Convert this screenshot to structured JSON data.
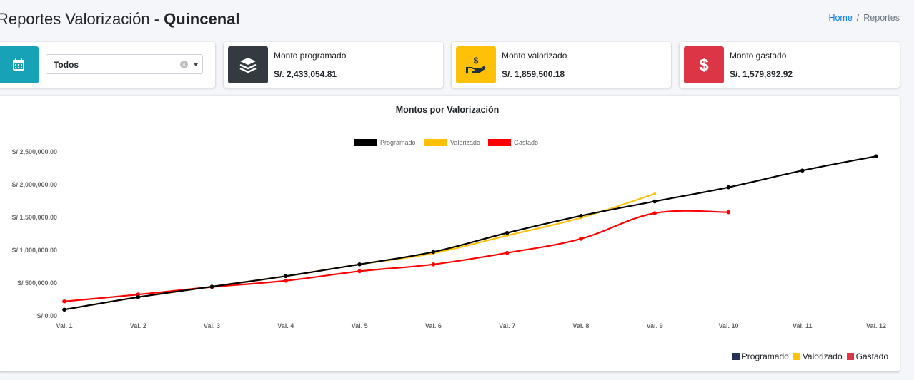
{
  "header": {
    "title_prefix": "Reportes Valorización - ",
    "title_bold": "Quincenal",
    "breadcrumb": {
      "home": "Home",
      "separator": "/",
      "current": "Reportes"
    }
  },
  "filter": {
    "icon": "calendar-icon",
    "selected": "Todos",
    "color": "#17a2b8"
  },
  "info_boxes": [
    {
      "label": "Monto programado",
      "value": "S/. 2,433,054.81",
      "icon": "layers-icon",
      "color": "#343a40"
    },
    {
      "label": "Monto valorizado",
      "value": "S/. 1,859,500.18",
      "icon": "hand-money-icon",
      "color": "#ffc107"
    },
    {
      "label": "Monto gastado",
      "value": "S/. 1,579,892.92",
      "icon": "dollar-icon",
      "color": "#dc3545"
    }
  ],
  "chart_data": {
    "type": "line",
    "title": "Montos por Valorización",
    "categories": [
      "Val. 1",
      "Val. 2",
      "Val. 3",
      "Val. 4",
      "Val. 5",
      "Val. 6",
      "Val. 7",
      "Val. 8",
      "Val. 9",
      "Val. 10",
      "Val. 11",
      "Val. 12"
    ],
    "y_ticks": [
      {
        "value": 0,
        "label": "S/ 0.00"
      },
      {
        "value": 500000,
        "label": "S/ 500,000.00"
      },
      {
        "value": 1000000,
        "label": "S/ 1,000,000.00"
      },
      {
        "value": 1500000,
        "label": "S/ 1,500,000.00"
      },
      {
        "value": 2000000,
        "label": "S/ 2,000,000.00"
      },
      {
        "value": 2500000,
        "label": "S/ 2,500,000.00"
      }
    ],
    "ylim": [
      0,
      2500000
    ],
    "grid": false,
    "legend_position": "top",
    "series": [
      {
        "name": "Programado",
        "color": "#000000",
        "values": [
          95000,
          285000,
          445000,
          605000,
          785000,
          975000,
          1265000,
          1525000,
          1745000,
          1960000,
          2215000,
          2433054.81
        ]
      },
      {
        "name": "Valorizado",
        "color": "#ffc107",
        "values": [
          95000,
          285000,
          445000,
          605000,
          785000,
          955000,
          1225000,
          1495000,
          1859500.18,
          null,
          null,
          null
        ]
      },
      {
        "name": "Gastado",
        "color": "#ff0000",
        "values": [
          220000,
          325000,
          440000,
          535000,
          680000,
          785000,
          960000,
          1175000,
          1565000,
          1579892.92,
          null,
          null
        ]
      }
    ]
  },
  "bottom_legend": [
    {
      "label": "Programado",
      "color": "#223355"
    },
    {
      "label": "Valorizado",
      "color": "#ffc107"
    },
    {
      "label": "Gastado",
      "color": "#dc3545"
    }
  ]
}
